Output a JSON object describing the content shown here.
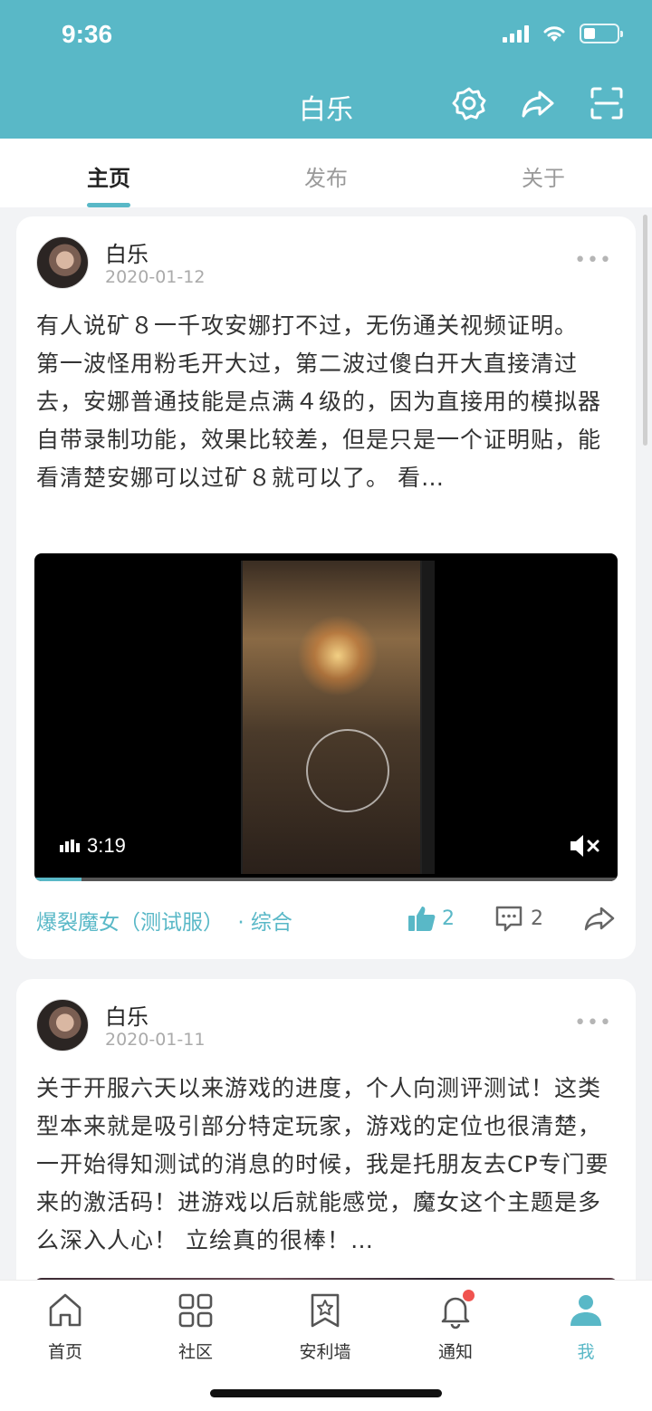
{
  "status_bar": {
    "time": "9:36"
  },
  "header": {
    "title": "白乐",
    "icons": [
      "gear-icon",
      "share-icon",
      "scan-icon"
    ]
  },
  "tabs": [
    {
      "label": "主页",
      "active": true
    },
    {
      "label": "发布",
      "active": false
    },
    {
      "label": "关于",
      "active": false
    }
  ],
  "posts": [
    {
      "author": "白乐",
      "date": "2020-01-12",
      "text": "有人说矿８一千攻安娜打不过，无伤通关视频证明。\n第一波怪用粉毛开大过，第二波过傻白开大直接清过去，安娜普通技能是点满４级的，因为直接用的模拟器自带录制功能，效果比较差，但是只是一个证明贴，能看清楚安娜可以过矿８就可以了。 看…",
      "video_duration": "3:19",
      "video_progress": 0.08,
      "tag": "爆裂魔女（测试服）",
      "category": "· 综合",
      "likes": "2",
      "comments": "2"
    },
    {
      "author": "白乐",
      "date": "2020-01-11",
      "text": "关于开服六天以来游戏的进度，个人向测评测试！这类型本来就是吸引部分特定玩家，游戏的定位也很清楚，一开始得知测试的消息的时候，我是托朋友去CP专门要来的激活码！进游戏以后就能感觉，魔女这个主题是多么深入人心！ 立绘真的很棒！…"
    }
  ],
  "bottom_nav": [
    {
      "label": "首页",
      "icon": "home-icon",
      "active": false
    },
    {
      "label": "社区",
      "icon": "grid-icon",
      "active": false
    },
    {
      "label": "安利墙",
      "icon": "bookmark-star-icon",
      "active": false
    },
    {
      "label": "通知",
      "icon": "bell-icon",
      "active": false,
      "badge": true
    },
    {
      "label": "我",
      "icon": "person-icon",
      "active": true
    }
  ],
  "colors": {
    "accent": "#59b8c7",
    "badge": "#f0534f"
  }
}
